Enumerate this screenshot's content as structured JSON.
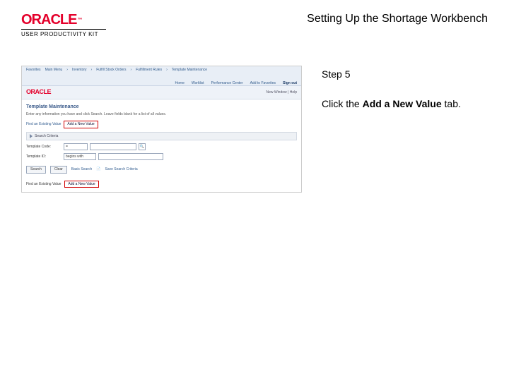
{
  "brand": {
    "name": "ORACLE",
    "tm": "™",
    "sub": "USER PRODUCTIVITY KIT"
  },
  "doc_title": "Setting Up the Shortage Workbench",
  "step_label": "Step 5",
  "instruction_pre": "Click the ",
  "instruction_bold": "Add a New Value",
  "instruction_post": " tab.",
  "shot": {
    "topnav": [
      "Favorites",
      "Main Menu",
      "Inventory",
      "Fulfill Stock Orders",
      "Fulfillment Rules",
      "Template Maintenance"
    ],
    "topnav2": [
      "Home",
      "Worklist",
      "Performance Center",
      "Add to Favorites"
    ],
    "topnav2_last": "Sign out",
    "oracle": "ORACLE",
    "newwin": "New Window | Help",
    "page_title": "Template Maintenance",
    "page_sub": "Enter any information you have and click Search. Leave fields blank for a list of all values.",
    "tab_find": "Find an Existing Value",
    "tab_add": "Add a New Value",
    "crit_label": "Search Criteria",
    "row1_label": "Template Code:",
    "row1_op": "=",
    "row2_label": "Template ID:",
    "row2_op": "begins with",
    "btn_search": "Search",
    "btn_clear": "Clear",
    "link_basic": "Basic Search",
    "link_save": "Save Search Criteria",
    "foot_text": "Find an Existing Value",
    "foot_chip": "Add a New Value"
  }
}
